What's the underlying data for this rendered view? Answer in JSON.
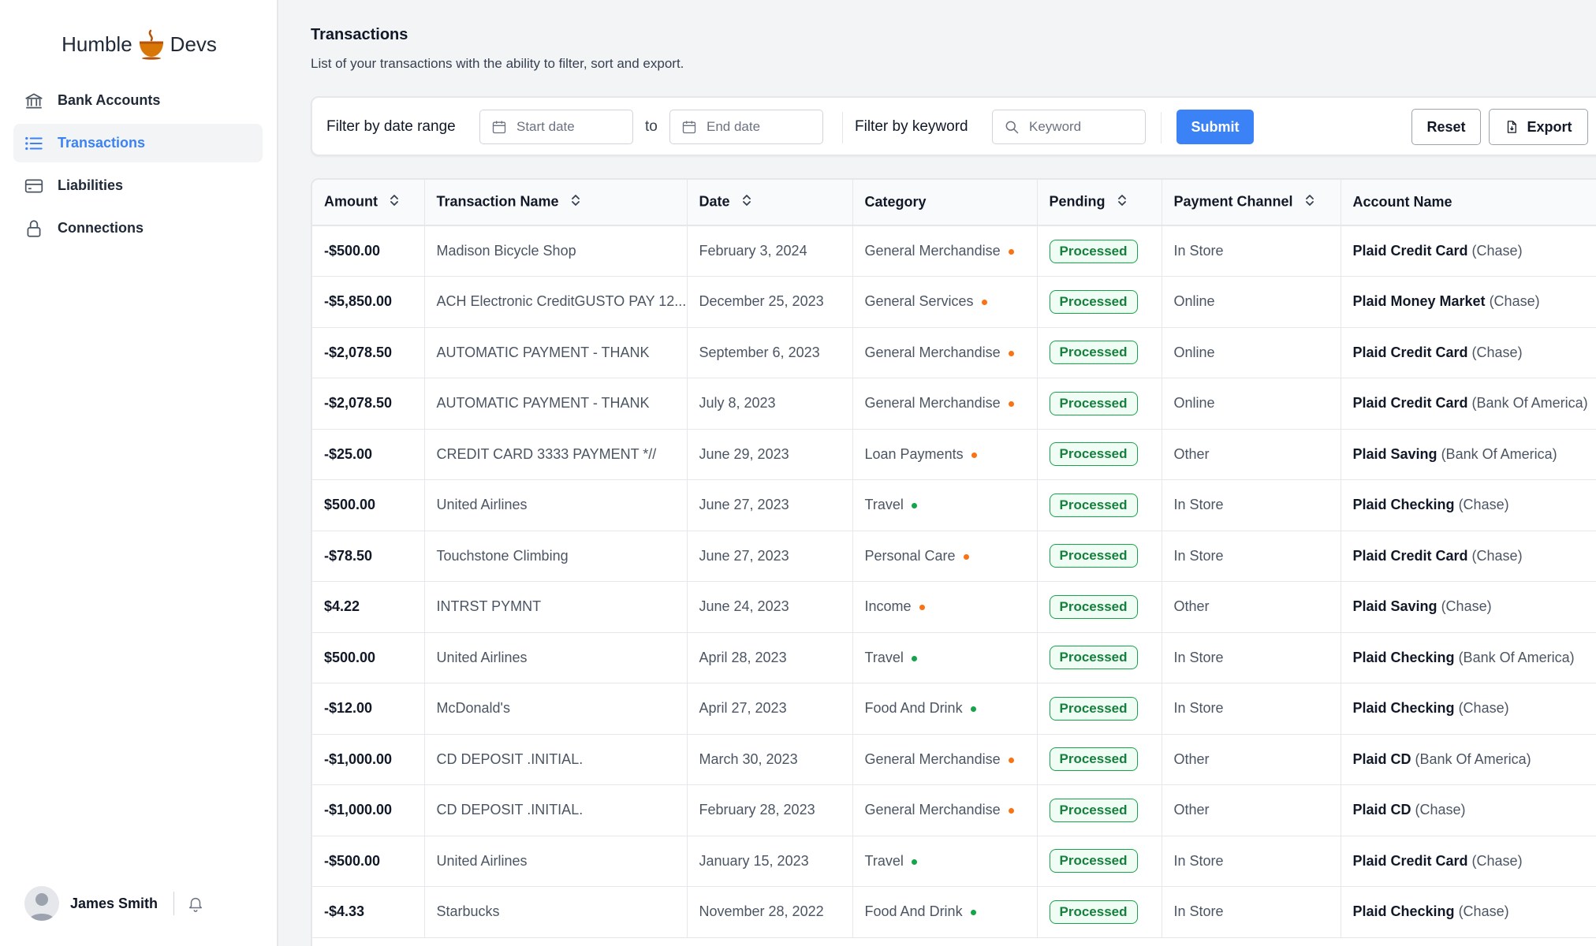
{
  "brand": {
    "name_left": "Humble",
    "name_right": "Devs",
    "accent": "#d97706"
  },
  "sidebar": {
    "items": [
      {
        "label": "Bank Accounts",
        "icon": "bank-icon",
        "active": false
      },
      {
        "label": "Transactions",
        "icon": "list-icon",
        "active": true
      },
      {
        "label": "Liabilities",
        "icon": "credit-card-icon",
        "active": false
      },
      {
        "label": "Connections",
        "icon": "lock-icon",
        "active": false
      }
    ],
    "user": {
      "name": "James Smith"
    }
  },
  "page": {
    "title": "Transactions",
    "subtitle": "List of your transactions with the ability to filter, sort and export."
  },
  "filters": {
    "date_label": "Filter by date range",
    "start_placeholder": "Start date",
    "to_label": "to",
    "end_placeholder": "End date",
    "keyword_label": "Filter by keyword",
    "keyword_placeholder": "Keyword",
    "submit_label": "Submit",
    "reset_label": "Reset",
    "export_label": "Export"
  },
  "table": {
    "columns": [
      "Amount",
      "Transaction Name",
      "Date",
      "Category",
      "Pending",
      "Payment Channel",
      "Account Name"
    ],
    "rows": [
      {
        "amount": "-$500.00",
        "name": "Madison Bicycle Shop",
        "date": "February 3, 2024",
        "category": "General Merchandise",
        "cat_color": "#f97316",
        "pending": "Processed",
        "channel": "In Store",
        "account": "Plaid Credit Card",
        "bank": "(Chase)"
      },
      {
        "amount": "-$5,850.00",
        "name": "ACH Electronic CreditGUSTO PAY 12...",
        "date": "December 25, 2023",
        "category": "General Services",
        "cat_color": "#f97316",
        "pending": "Processed",
        "channel": "Online",
        "account": "Plaid Money Market",
        "bank": "(Chase)"
      },
      {
        "amount": "-$2,078.50",
        "name": "AUTOMATIC PAYMENT - THANK",
        "date": "September 6, 2023",
        "category": "General Merchandise",
        "cat_color": "#f97316",
        "pending": "Processed",
        "channel": "Online",
        "account": "Plaid Credit Card",
        "bank": "(Chase)"
      },
      {
        "amount": "-$2,078.50",
        "name": "AUTOMATIC PAYMENT - THANK",
        "date": "July 8, 2023",
        "category": "General Merchandise",
        "cat_color": "#f97316",
        "pending": "Processed",
        "channel": "Online",
        "account": "Plaid Credit Card",
        "bank": "(Bank Of America)"
      },
      {
        "amount": "-$25.00",
        "name": "CREDIT CARD 3333 PAYMENT *//",
        "date": "June 29, 2023",
        "category": "Loan Payments",
        "cat_color": "#f97316",
        "pending": "Processed",
        "channel": "Other",
        "account": "Plaid Saving",
        "bank": "(Bank Of America)"
      },
      {
        "amount": "$500.00",
        "name": "United Airlines",
        "date": "June 27, 2023",
        "category": "Travel",
        "cat_color": "#16a34a",
        "pending": "Processed",
        "channel": "In Store",
        "account": "Plaid Checking",
        "bank": "(Chase)"
      },
      {
        "amount": "-$78.50",
        "name": "Touchstone Climbing",
        "date": "June 27, 2023",
        "category": "Personal Care",
        "cat_color": "#f97316",
        "pending": "Processed",
        "channel": "In Store",
        "account": "Plaid Credit Card",
        "bank": "(Chase)"
      },
      {
        "amount": "$4.22",
        "name": "INTRST PYMNT",
        "date": "June 24, 2023",
        "category": "Income",
        "cat_color": "#f97316",
        "pending": "Processed",
        "channel": "Other",
        "account": "Plaid Saving",
        "bank": "(Chase)"
      },
      {
        "amount": "$500.00",
        "name": "United Airlines",
        "date": "April 28, 2023",
        "category": "Travel",
        "cat_color": "#16a34a",
        "pending": "Processed",
        "channel": "In Store",
        "account": "Plaid Checking",
        "bank": "(Bank Of America)"
      },
      {
        "amount": "-$12.00",
        "name": "McDonald's",
        "date": "April 27, 2023",
        "category": "Food And Drink",
        "cat_color": "#16a34a",
        "pending": "Processed",
        "channel": "In Store",
        "account": "Plaid Checking",
        "bank": "(Chase)"
      },
      {
        "amount": "-$1,000.00",
        "name": "CD DEPOSIT .INITIAL.",
        "date": "March 30, 2023",
        "category": "General Merchandise",
        "cat_color": "#f97316",
        "pending": "Processed",
        "channel": "Other",
        "account": "Plaid CD",
        "bank": "(Bank Of America)"
      },
      {
        "amount": "-$1,000.00",
        "name": "CD DEPOSIT .INITIAL.",
        "date": "February 28, 2023",
        "category": "General Merchandise",
        "cat_color": "#f97316",
        "pending": "Processed",
        "channel": "Other",
        "account": "Plaid CD",
        "bank": "(Chase)"
      },
      {
        "amount": "-$500.00",
        "name": "United Airlines",
        "date": "January 15, 2023",
        "category": "Travel",
        "cat_color": "#16a34a",
        "pending": "Processed",
        "channel": "In Store",
        "account": "Plaid Credit Card",
        "bank": "(Chase)"
      },
      {
        "amount": "-$4.33",
        "name": "Starbucks",
        "date": "November 28, 2022",
        "category": "Food And Drink",
        "cat_color": "#16a34a",
        "pending": "Processed",
        "channel": "In Store",
        "account": "Plaid Checking",
        "bank": "(Chase)"
      }
    ]
  },
  "colors": {
    "primary": "#3b82f6",
    "processed": "#16a34a",
    "warning_dot": "#f97316",
    "success_dot": "#16a34a"
  }
}
